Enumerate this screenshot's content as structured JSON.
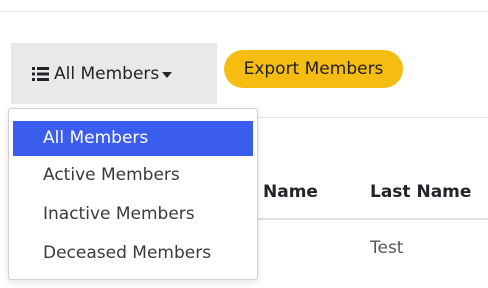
{
  "toolbar": {
    "filter_label": "All Members",
    "filter_icon": "list-icon",
    "caret_icon": "caret-down-icon",
    "export_label": "Export Members",
    "export_color": "#f5bd12"
  },
  "dropdown": {
    "items": [
      {
        "label": "All Members",
        "active": true
      },
      {
        "label": "Active Members",
        "active": false
      },
      {
        "label": "Inactive Members",
        "active": false
      },
      {
        "label": "Deceased Members",
        "active": false
      }
    ],
    "active_color": "#3b5ded"
  },
  "table": {
    "columns": [
      "Name",
      "Last Name"
    ],
    "rows": [
      {
        "last_name": "Test"
      }
    ]
  }
}
